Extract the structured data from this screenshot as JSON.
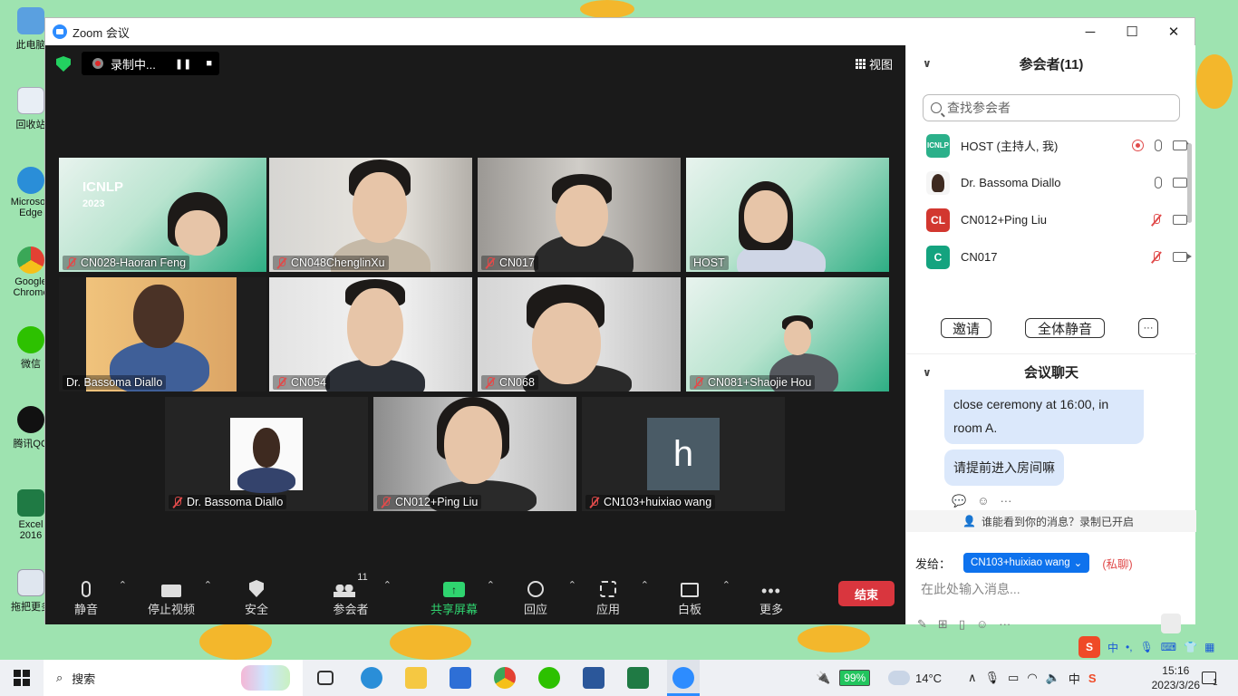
{
  "window": {
    "title": "Zoom 会议",
    "controls": [
      "─",
      "☐",
      "✕"
    ]
  },
  "recording": {
    "label": "录制中...",
    "pause": "❚❚",
    "stop": "■"
  },
  "view_button": "视图",
  "tiles": [
    {
      "label": "CN028-Haoran Feng",
      "muted": true,
      "active": true
    },
    {
      "label": "CN048ChenglinXu",
      "muted": true
    },
    {
      "label": "CN017",
      "muted": true
    },
    {
      "label": "HOST",
      "muted": false
    },
    {
      "label": "Dr. Bassoma Diallo",
      "muted": false
    },
    {
      "label": "CN054",
      "muted": true
    },
    {
      "label": "CN068",
      "muted": true
    },
    {
      "label": "CN081+Shaojie Hou",
      "muted": true
    },
    {
      "label": "Dr. Bassoma Diallo",
      "muted": true
    },
    {
      "label": "CN012+Ping Liu",
      "muted": true
    },
    {
      "label": "CN103+huixiao wang",
      "muted": true,
      "avatar_letter": "h"
    }
  ],
  "slide": {
    "brand": "ICNLP",
    "year": "2023"
  },
  "toolbar": {
    "mute": "静音",
    "stop_video": "停止视频",
    "security": "安全",
    "participants": "参会者",
    "participants_count": "11",
    "share": "共享屏幕",
    "reactions": "回应",
    "apps": "应用",
    "whiteboard": "白板",
    "more": "更多",
    "end": "结束"
  },
  "panel": {
    "participants_title": "参会者(11)",
    "search_placeholder": "查找参会者",
    "participants": [
      {
        "name": "HOST (主持人, 我)",
        "avatar": "ICNLP",
        "avatar_color": "#2bb08a"
      },
      {
        "name": "Dr. Bassoma Diallo",
        "avatar": "",
        "avatar_color": "#6b4a3a"
      },
      {
        "name": "CN012+Ping Liu",
        "avatar": "CL",
        "avatar_color": "#d2372f"
      },
      {
        "name": "CN017",
        "avatar": "C",
        "avatar_color": "#14a37f"
      }
    ],
    "invite": "邀请",
    "mute_all": "全体静音",
    "more": "···",
    "chat_title": "会议聊天",
    "messages": [
      {
        "line1": "close ceremony at 16:00, in",
        "line2": "room A."
      },
      {
        "line1": "请提前进入房间嘛"
      }
    ],
    "recording_note": "谁能看到你的消息？录制已开启",
    "send_to_label": "发给：",
    "send_to_value": "CN103+huixiao wang",
    "private_label": "(私聊)",
    "input_placeholder": "在此处输入消息..."
  },
  "desktop_icons": [
    "此电脑",
    "回收站",
    "Microsoft Edge",
    "Google Chrome",
    "微信",
    "腾讯QQ",
    "Excel 2016",
    "拖把更多"
  ],
  "taskbar": {
    "search": "搜索",
    "battery": "99%",
    "weather": "14°C",
    "ime": "中",
    "time": "15:16",
    "date": "2023/3/26",
    "notification_count": "1"
  }
}
